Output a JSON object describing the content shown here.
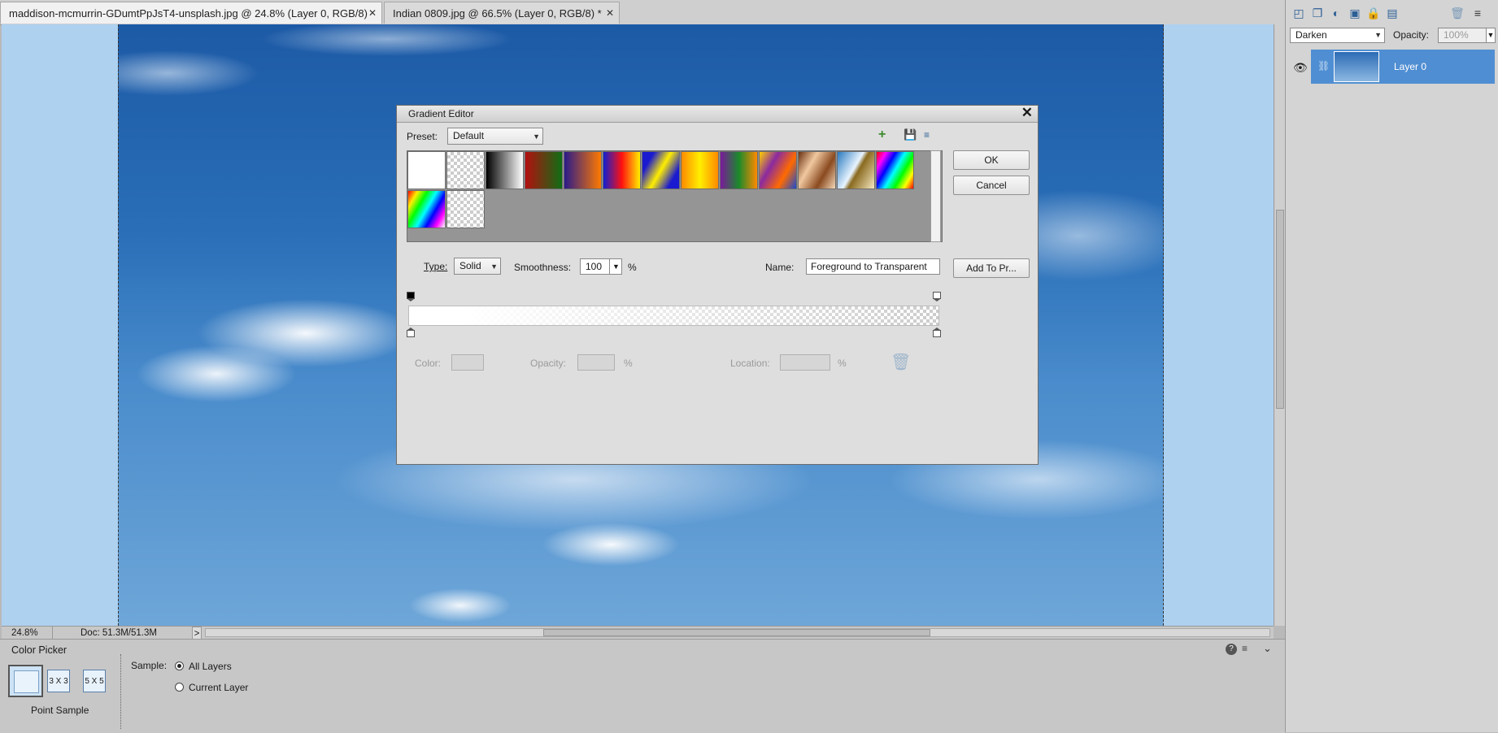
{
  "tabs": [
    {
      "label": "maddison-mcmurrin-GDumtPpJsT4-unsplash.jpg @ 24.8% (Layer 0, RGB/8) *",
      "active": true
    },
    {
      "label": "Indian 0809.jpg @ 66.5% (Layer 0, RGB/8) *",
      "active": false
    }
  ],
  "status": {
    "zoom": "24.8%",
    "doc": "Doc: 51.3M/51.3M",
    "arrow": ">"
  },
  "tool_options": {
    "title": "Color Picker",
    "btn_3x3": "3 X 3",
    "btn_5x5": "5 X 5",
    "point_sample": "Point Sample",
    "sample_label": "Sample:",
    "all_layers": "All Layers",
    "current_layer": "Current Layer",
    "selected": "All Layers"
  },
  "layers_panel": {
    "blend_mode": "Darken",
    "opacity_label": "Opacity:",
    "opacity_value": "100%",
    "layer_name": "Layer 0"
  },
  "dialog": {
    "title": "Gradient Editor",
    "preset_label": "Preset:",
    "preset_value": "Default",
    "ok": "OK",
    "cancel": "Cancel",
    "add_to_presets": "Add To Pr...",
    "type_label": "Type:",
    "type_value": "Solid",
    "smoothness_label": "Smoothness:",
    "smoothness_value": "100",
    "percent": "%",
    "name_label": "Name:",
    "name_value": "Foreground to Transparent",
    "color_label": "Color:",
    "opacity_label": "Opacity:",
    "location_label": "Location:",
    "presets": [
      "foreground-to-background",
      "foreground-to-transparent",
      "black-white",
      "red-green",
      "violet-orange",
      "blue-red-yellow",
      "blue-yellow-blue",
      "orange-yellow-orange",
      "violet-green-orange",
      "yellow-violet-orange-blue",
      "copper",
      "chrome",
      "spectrum",
      "transparent-rainbow",
      "transparent-stripes"
    ]
  },
  "colors": {
    "accent": "#4f8ed2",
    "sky_dark": "#1d5aa6",
    "canvas_bg": "#aed1f0"
  }
}
